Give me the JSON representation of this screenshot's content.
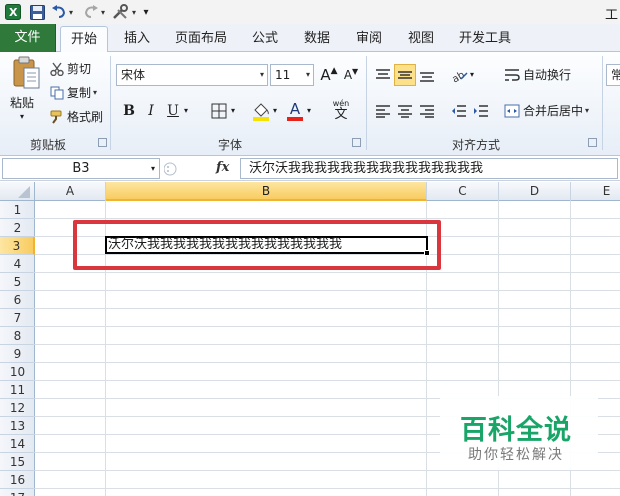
{
  "title_bar": {
    "app_title": "工",
    "undo_icon": "undo-icon",
    "redo_icon": "redo-icon",
    "save_icon": "save-icon",
    "excel_icon": "excel-logo-icon"
  },
  "tabs": [
    {
      "label": "文件"
    },
    {
      "label": "开始"
    },
    {
      "label": "插入"
    },
    {
      "label": "页面布局"
    },
    {
      "label": "公式"
    },
    {
      "label": "数据"
    },
    {
      "label": "审阅"
    },
    {
      "label": "视图"
    },
    {
      "label": "开发工具"
    }
  ],
  "ribbon": {
    "clipboard": {
      "paste_label": "粘贴",
      "cut_label": "剪切",
      "copy_label": "复制",
      "format_painter_label": "格式刷",
      "group_label": "剪贴板"
    },
    "font": {
      "font_name": "宋体",
      "font_size": "11",
      "bold": "B",
      "italic": "I",
      "underline": "U",
      "font_color_letter": "A",
      "grow_letter": "A",
      "shrink_letter": "A",
      "wen_label": "wén",
      "wen_char": "文",
      "group_label": "字体",
      "font_color": "#e8221b",
      "fill_color": "#f5e200"
    },
    "alignment": {
      "wrap_text_label": "自动换行",
      "merge_center_label": "合并后居中",
      "group_label": "对齐方式",
      "partial_label": "常"
    }
  },
  "formula_bar": {
    "name_box": "B3",
    "fx_label": "fx",
    "content": "沃尔沃我我我我我我我我我我我我我我我"
  },
  "sheet": {
    "columns": [
      "A",
      "B",
      "C",
      "D",
      "E"
    ],
    "rows": [
      "1",
      "2",
      "3",
      "4",
      "5",
      "6",
      "7",
      "8",
      "9",
      "10",
      "11",
      "12",
      "13",
      "14",
      "15",
      "16",
      "17"
    ],
    "selected_column": "B",
    "selected_row": "3",
    "cell_b3": "沃尔沃我我我我我我我我我我我我我我我",
    "highlight_color": "#d9363e"
  },
  "watermark": {
    "title": "百科全说",
    "subtitle": "助你轻松解决"
  }
}
